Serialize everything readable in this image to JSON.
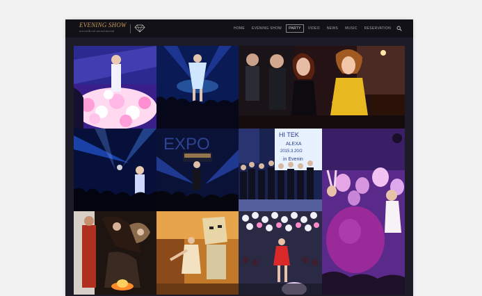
{
  "brand": {
    "name": "EVENING SHOW",
    "tagline": "ครบวงจรอีเวนท์ เอนเตอร์เทนเมนท์"
  },
  "nav": {
    "items": [
      {
        "label": "HOME"
      },
      {
        "label": "EVENING SHOW"
      },
      {
        "label": "PARTY",
        "active": true
      },
      {
        "label": "VIDEO"
      },
      {
        "label": "NEWS"
      },
      {
        "label": "MUSIC"
      },
      {
        "label": "RESERVATION"
      }
    ]
  },
  "photos": {
    "t2": {
      "sign": "EXPO"
    },
    "t3": {
      "sign1": "HI TEK",
      "sign2": "ALEXA",
      "sign3": "2015.3.20/2",
      "sign4": "in Evenin"
    }
  },
  "colors": {
    "nav_bg": "#121117",
    "page_bg": "#1d1b28",
    "accent_gold": "#c79a58"
  },
  "icons": [
    "diamond-logo-icon",
    "search-icon"
  ]
}
